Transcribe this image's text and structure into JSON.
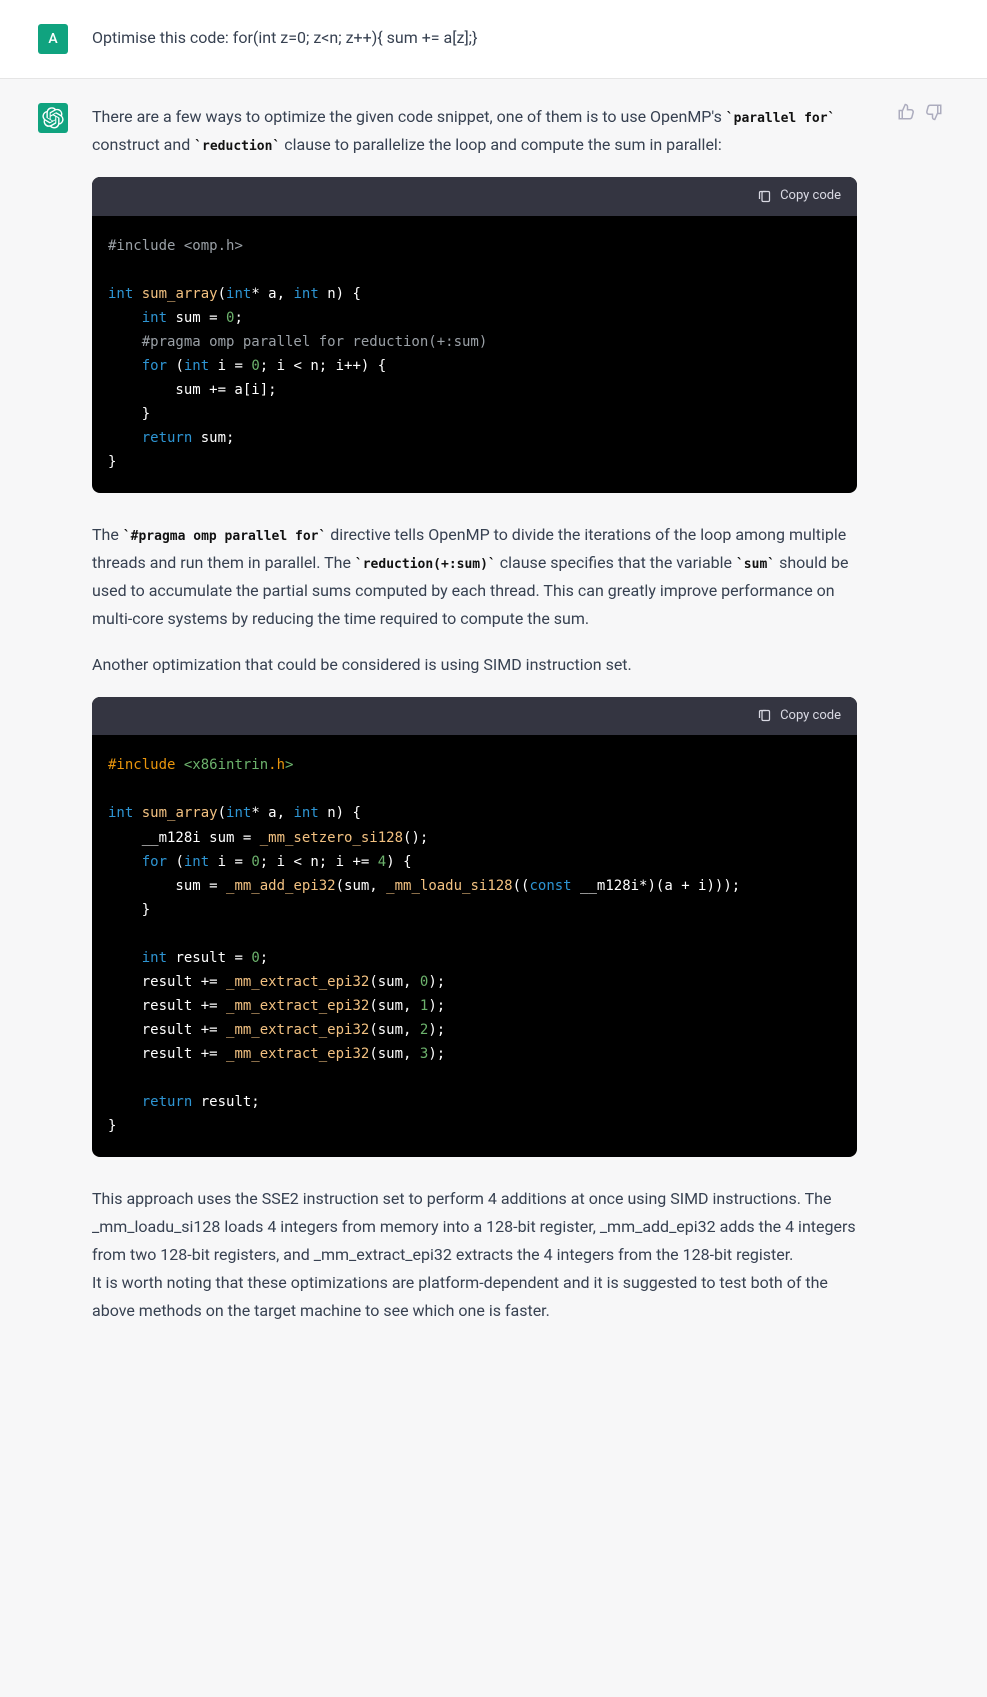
{
  "user": {
    "avatar_letter": "A",
    "message": "Optimise this code: for(int z=0; z<n; z++){ sum += a[z];}"
  },
  "assistant": {
    "para1_parts": {
      "a": "There are a few ways to optimize the given code snippet, one of them is to use OpenMP's ",
      "code1": "`parallel for`",
      "b": " construct and ",
      "code2": "`reduction`",
      "c": " clause to parallelize the loop and compute the sum in parallel:"
    },
    "code1": {
      "copy_label": "Copy code",
      "tokens": {
        "include": "#include",
        "header": " <omp.h>",
        "kw_int": "int",
        "fn": "sum_array",
        "sig_rest": "(",
        "star_a": "* a, ",
        "n_close": " n) {",
        "sum_decl": " sum = ",
        "zero": "0",
        "semi": ";",
        "pragma": "    #pragma omp parallel for reduction(+:sum)",
        "for": "for",
        "for_open": " (",
        "i_eq": " i = ",
        "cond": "; i < n; i++) {",
        "body": "        sum += a[i];",
        "close_in": "    }",
        "return": "return",
        "ret_rest": " sum;",
        "close": "}"
      }
    },
    "para2_parts": {
      "a": "The ",
      "code1": "`#pragma omp parallel for`",
      "b": " directive tells OpenMP to divide the iterations of the loop among multiple threads and run them in parallel. The ",
      "code2": "`reduction(+:sum)`",
      "c": " clause specifies that the variable ",
      "code3": "`sum`",
      "d": " should be used to accumulate the partial sums computed by each thread. This can greatly improve performance on multi-core systems by reducing the time required to compute the sum."
    },
    "para3": "Another optimization that could be considered is using SIMD instruction set.",
    "code2": {
      "copy_label": "Copy code",
      "tokens": {
        "include": "#include",
        "header_open": " <x86intrin",
        "header_dot": ".h",
        "header_close": ">",
        "kw_int": "int",
        "fn": "sum_array",
        "sig_open": "(",
        "star_a": "* a, ",
        "n_close": " n) {",
        "m128": "    __m128i sum = ",
        "setzero": "_mm_setzero_si128",
        "call_close": "();",
        "for": "for",
        "for_open": " (",
        "i_eq": " i = ",
        "zero": "0",
        "cond_a": "; i < n; i += ",
        "four": "4",
        "cond_b": ") {",
        "body_a": "        sum = ",
        "addfn": "_mm_add_epi32",
        "body_b": "(sum, ",
        "loadfn": "_mm_loadu_si128",
        "body_c": "((",
        "const": "const",
        "body_d": " __m128i*)(a + i)));",
        "close_in": "    }",
        "res_decl_a": " result = ",
        "res_zero": "0",
        "semi": ";",
        "ext_a": "    result += ",
        "extfn": "_mm_extract_epi32",
        "ext_b": "(sum, ",
        "n0": "0",
        "n1": "1",
        "n2": "2",
        "n3": "3",
        "ext_c": ");",
        "return": "return",
        "ret_rest": " result;",
        "close": "}"
      }
    },
    "para4": "This approach uses the SSE2 instruction set to perform 4 additions at once using SIMD instructions. The _mm_loadu_si128 loads 4 integers from memory into a 128-bit register, _mm_add_epi32 adds the 4 integers from two 128-bit registers, and _mm_extract_epi32 extracts the 4 integers from the 128-bit register.",
    "para5": "It is worth noting that these optimizations are platform-dependent and it is suggested to test both of the above methods on the target machine to see which one is faster."
  }
}
